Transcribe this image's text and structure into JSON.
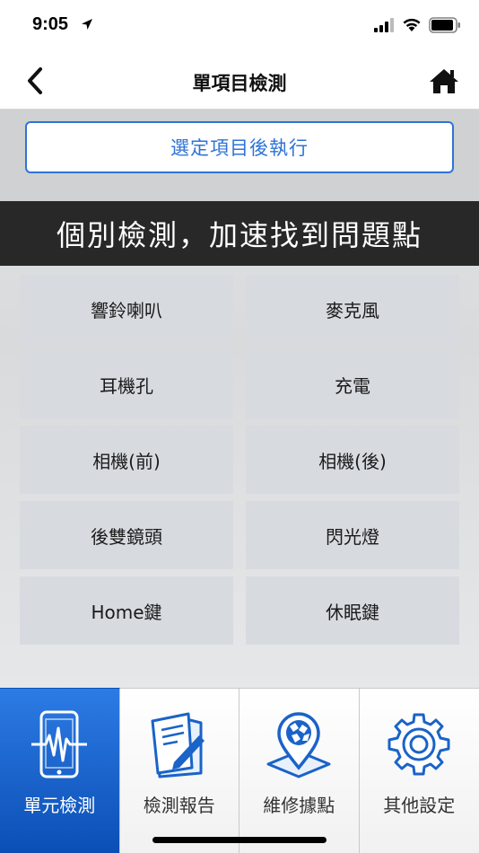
{
  "status_bar": {
    "time": "9:05"
  },
  "nav": {
    "title": "單項目檢測"
  },
  "run_button": {
    "label": "選定項目後執行"
  },
  "banner": {
    "text": "個別檢測，加速找到問題點"
  },
  "items": [
    {
      "label": "響鈴喇叭"
    },
    {
      "label": "麥克風"
    },
    {
      "label": "耳機孔"
    },
    {
      "label": "充電"
    },
    {
      "label": "相機(前)"
    },
    {
      "label": "相機(後)"
    },
    {
      "label": "後雙鏡頭"
    },
    {
      "label": "閃光燈"
    },
    {
      "label": "Home鍵"
    },
    {
      "label": "休眠鍵"
    }
  ],
  "tabs": [
    {
      "label": "單元檢測",
      "icon": "phone-pulse-icon",
      "active": true
    },
    {
      "label": "檢測報告",
      "icon": "report-icon",
      "active": false
    },
    {
      "label": "維修據點",
      "icon": "location-pin-icon",
      "active": false
    },
    {
      "label": "其他設定",
      "icon": "gear-icon",
      "active": false
    }
  ],
  "colors": {
    "accent": "#2f73d6",
    "active_tab": "#1565d0",
    "banner_bg": "#282828",
    "item_bg": "#d7dbe0"
  }
}
